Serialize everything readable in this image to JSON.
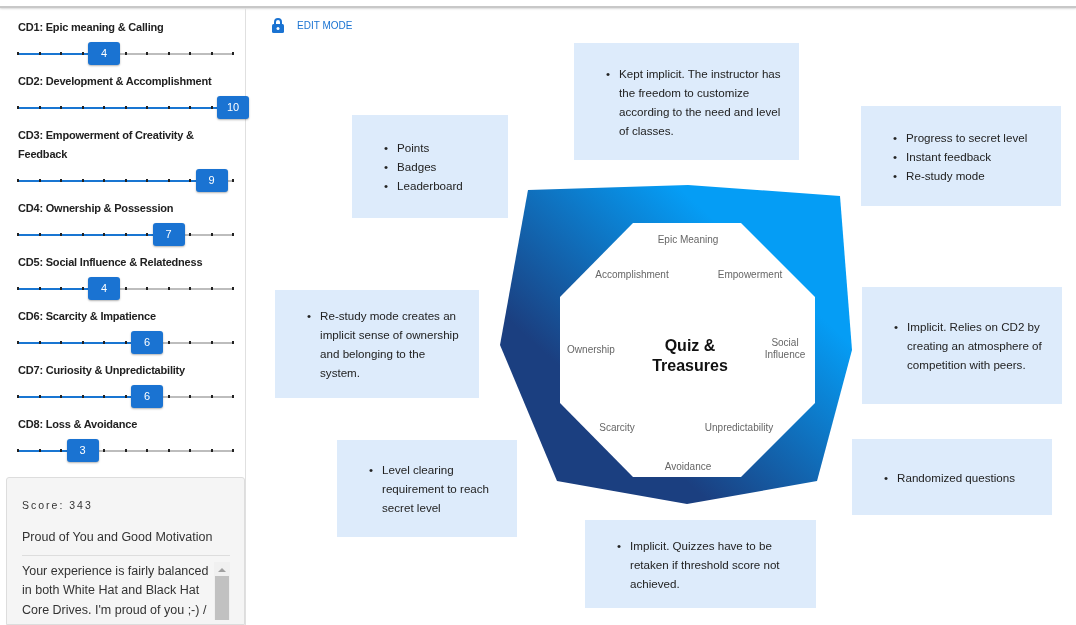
{
  "sliders": [
    {
      "label": "CD1: Epic meaning & Calling",
      "value": "4",
      "level": 0.4
    },
    {
      "label": "CD2: Development & Accomplishment",
      "value": "10",
      "level": 1.0
    },
    {
      "label": "CD3: Empowerment of Creativity & Feedback",
      "value": "9",
      "level": 0.9
    },
    {
      "label": "CD4: Ownership & Possession",
      "value": "7",
      "level": 0.7
    },
    {
      "label": "CD5: Social Influence & Relatedness",
      "value": "4",
      "level": 0.4
    },
    {
      "label": "CD6: Scarcity & Impatience",
      "value": "6",
      "level": 0.6
    },
    {
      "label": "CD7: Curiosity & Unpredictability",
      "value": "6",
      "level": 0.6
    },
    {
      "label": "CD8: Loss & Avoidance",
      "value": "3",
      "level": 0.3
    }
  ],
  "score": {
    "label": "Score: 343",
    "title": "Proud of You and Good Motivation",
    "text": "Your experience is fairly balanced in both White Hat and Black Hat Core Drives. I'm proud of you ;-) /"
  },
  "edit_mode": "EDIT MODE",
  "octagon": {
    "title": "Quiz & Treasures",
    "drives": [
      "Epic Meaning",
      "Empowerment",
      "Social Influence",
      "Unpredictability",
      "Avoidance",
      "Scarcity",
      "Ownership",
      "Accomplishment"
    ]
  },
  "notes": [
    {
      "marker": "•",
      "items": [
        "Kept implicit. The instructor has the freedom to customize according to the need and level of classes."
      ]
    },
    {
      "marker": "•",
      "items": [
        "Progress to secret level",
        "Instant feedback",
        "Re-study mode"
      ]
    },
    {
      "marker": "•",
      "items": [
        "Points",
        "Badges",
        "Leaderboard"
      ]
    },
    {
      "marker": "•",
      "items": [
        "Re-study mode creates an implicit sense of ownership and belonging to the system."
      ]
    },
    {
      "marker": "•",
      "items": [
        "Implicit. Relies on CD2 by creating an atmosphere of competition with peers."
      ]
    },
    {
      "marker": "•",
      "items": [
        "Randomized questions"
      ]
    },
    {
      "marker": "•",
      "items": [
        "Level clearing requirement to reach secret level"
      ]
    },
    {
      "marker": "•",
      "items": [
        "Implicit. Quizzes have to be retaken if threshold score not achieved."
      ]
    }
  ]
}
